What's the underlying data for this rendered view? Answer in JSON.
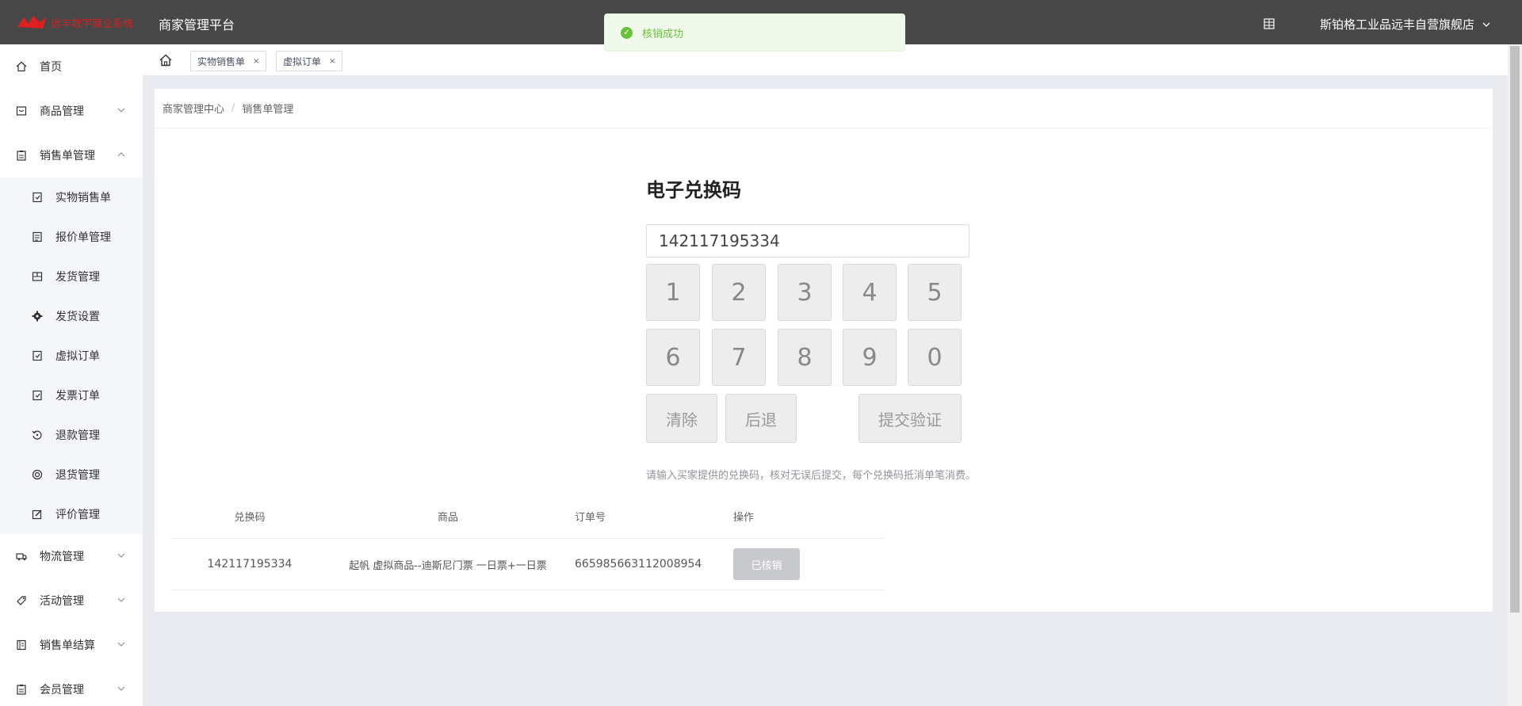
{
  "header": {
    "logo_text": "远丰数字商业系统",
    "platform_title": "商家管理平台",
    "store_name": "斯铂格工业品远丰自营旗舰店"
  },
  "toast": {
    "message": "核销成功"
  },
  "sidebar": {
    "items": [
      {
        "label": "首页"
      },
      {
        "label": "商品管理"
      },
      {
        "label": "销售单管理"
      }
    ],
    "sub_items": [
      {
        "label": "实物销售单"
      },
      {
        "label": "报价单管理"
      },
      {
        "label": "发货管理"
      },
      {
        "label": "发货设置"
      },
      {
        "label": "虚拟订单"
      },
      {
        "label": "发票订单"
      },
      {
        "label": "退款管理"
      },
      {
        "label": "退货管理"
      },
      {
        "label": "评价管理"
      }
    ],
    "items_after": [
      {
        "label": "物流管理"
      },
      {
        "label": "活动管理"
      },
      {
        "label": "销售单结算"
      },
      {
        "label": "会员管理"
      }
    ]
  },
  "tabs": [
    {
      "label": "实物销售单"
    },
    {
      "label": "虚拟订单"
    }
  ],
  "breadcrumb": {
    "root": "商家管理中心",
    "current": "销售单管理"
  },
  "verify": {
    "title": "电子兑换码",
    "code_value": "142117195334",
    "keys": [
      "1",
      "2",
      "3",
      "4",
      "5",
      "6",
      "7",
      "8",
      "9",
      "0"
    ],
    "clear_label": "清除",
    "back_label": "后退",
    "submit_label": "提交验证",
    "hint": "请输入买家提供的兑换码，核对无误后提交，每个兑换码抵消单笔消费。"
  },
  "table": {
    "headers": {
      "code": "兑换码",
      "product": "商品",
      "order": "订单号",
      "action": "操作"
    },
    "rows": [
      {
        "code": "142117195334",
        "product": "起帆 虚拟商品--迪斯尼门票 一日票+一日票",
        "order": "665985663112008954",
        "action": "已核销"
      }
    ]
  }
}
